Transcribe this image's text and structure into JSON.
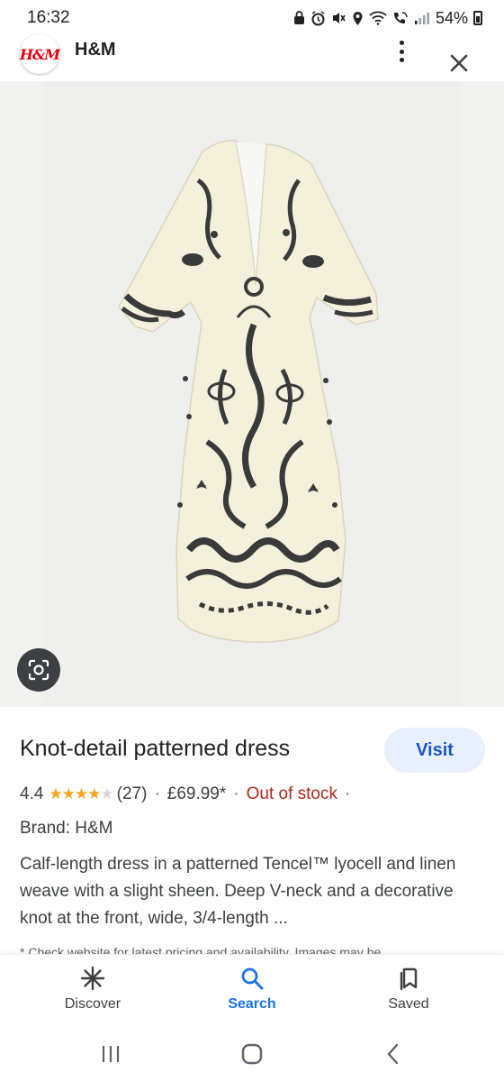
{
  "status_bar": {
    "time": "16:32",
    "battery": "54%",
    "icons": [
      "lock-icon",
      "alarm-icon",
      "mute-icon",
      "location-icon",
      "wifi-icon",
      "call-icon",
      "signal-icon",
      "battery-icon"
    ]
  },
  "site": {
    "logo_text": "H&M",
    "name": "H&M"
  },
  "product": {
    "image_alt": "Knot-detail patterned dress",
    "title": "Knot-detail patterned dress",
    "visit_label": "Visit",
    "rating": "4.4",
    "rating_value": 4.4,
    "stars": "★★★★",
    "half_star": "★",
    "reviews": "(27)",
    "separator": "·",
    "price": "£69.99*",
    "availability": "Out of stock",
    "brand": "Brand: H&M",
    "description": "Calf-length dress in a patterned Tencel™ lyocell and linen weave with a slight sheen. Deep V-neck and a decorative knot at the front, wide, 3/4-length ...",
    "disclaimer": "* Check website for latest pricing and availability. Images may be"
  },
  "bottom_nav": {
    "discover": "Discover",
    "search": "Search",
    "saved": "Saved",
    "active": "search"
  },
  "colors": {
    "accent": "#1a73e8",
    "visit_bg": "#e8f0fe",
    "out_of_stock": "#b3261e",
    "star": "#f5a623",
    "dress_base": "#f4f0dc",
    "dress_print": "#3a3a3a"
  }
}
